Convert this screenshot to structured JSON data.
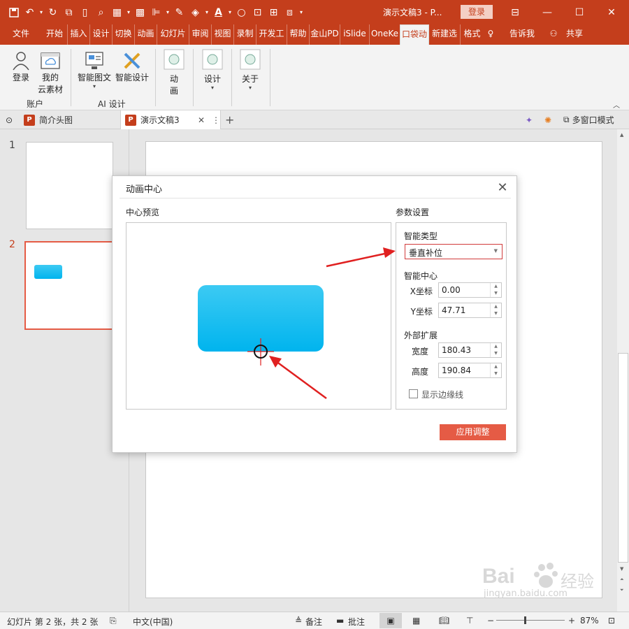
{
  "titlebar": {
    "doc_title": "演示文稿3 - P...",
    "login_label": "登录"
  },
  "tabs": [
    "文件",
    "开始",
    "插入",
    "设计",
    "切换",
    "动画",
    "幻灯片",
    "审阅",
    "视图",
    "录制",
    "开发工",
    "帮助",
    "金山PD",
    "iSlide",
    "OneKe",
    "口袋动",
    "新建选",
    "格式",
    "告诉我",
    "共享"
  ],
  "ribbon": {
    "login": "登录",
    "cloud_line1": "我的",
    "cloud_line2": "云素材",
    "group_account": "账户",
    "smart_image": "智能图文",
    "smart_design": "智能设计",
    "group_ai": "AI 设计",
    "anim_line1": "动",
    "anim_line2": "画",
    "design": "设计",
    "about": "关于"
  },
  "doctabs": {
    "tab1": "简介头图",
    "tab2": "演示文稿3",
    "multiwin": "多窗口模式",
    "ppt_letter": "P"
  },
  "thumbs": {
    "n1": "1",
    "n2": "2"
  },
  "dialog": {
    "title": "动画中心",
    "preview_label": "中心预览",
    "params_label": "参数设置",
    "smart_type_label": "智能类型",
    "smart_type_value": "垂直补位",
    "smart_center_label": "智能中心",
    "x_label": "X坐标",
    "x_value": "0.00",
    "y_label": "Y坐标",
    "y_value": "47.71",
    "extend_label": "外部扩展",
    "width_label": "宽度",
    "width_value": "180.43",
    "height_label": "高度",
    "height_value": "190.84",
    "show_border": "显示边缘线",
    "apply": "应用调整"
  },
  "statusbar": {
    "slide_info": "幻灯片 第 2 张，共 2 张",
    "language": "中文(中国)",
    "notes": "备注",
    "comments": "批注",
    "zoom": "87%"
  },
  "watermark": {
    "brand": "Bai",
    "brand_cn": "经验",
    "url": "jingyan.baidu.com"
  },
  "colors": {
    "accent": "#c43e1c",
    "apply_button": "#e55b45",
    "shape_top": "#3ccaf3",
    "shape_bottom": "#00b4ee",
    "arrow": "#e02020",
    "highlight_border": "#d13b3b"
  }
}
